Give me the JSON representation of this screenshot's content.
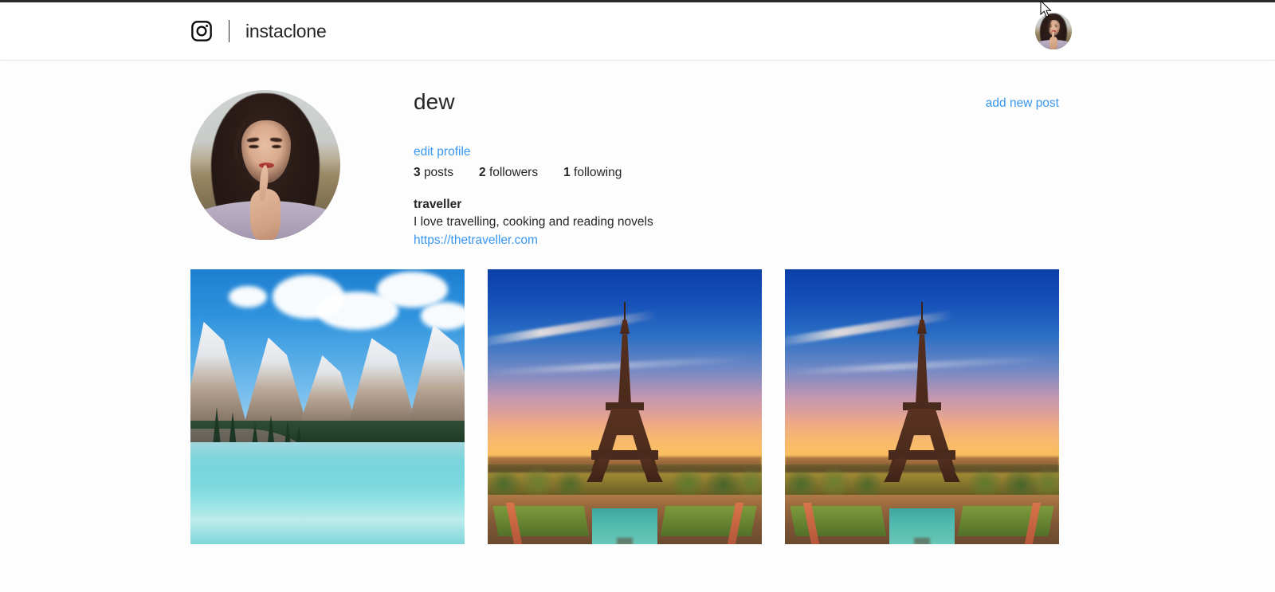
{
  "header": {
    "logo_icon": "instagram-camera-icon",
    "brand_name": "instaclone",
    "avatar_alt": "user-avatar"
  },
  "profile": {
    "username": "dew",
    "edit_profile_label": "edit profile",
    "add_post_label": "add new post",
    "stats": [
      {
        "num": "3",
        "label": "posts"
      },
      {
        "num": "2",
        "label": "followers"
      },
      {
        "num": "1",
        "label": "following"
      }
    ],
    "bio_name": "traveller",
    "bio_text": "I love travelling, cooking and reading novels",
    "bio_link": "https://thetraveller.com"
  },
  "posts": [
    {
      "alt": "mountain-lake-photo"
    },
    {
      "alt": "eiffel-tower-sunset-photo"
    },
    {
      "alt": "eiffel-tower-sunset-photo"
    }
  ],
  "colors": {
    "link": "#3897f0",
    "text": "#262626",
    "background": "#fdfdfd",
    "header_bg": "#ffffff",
    "top_strip": "#2b2b2b"
  }
}
